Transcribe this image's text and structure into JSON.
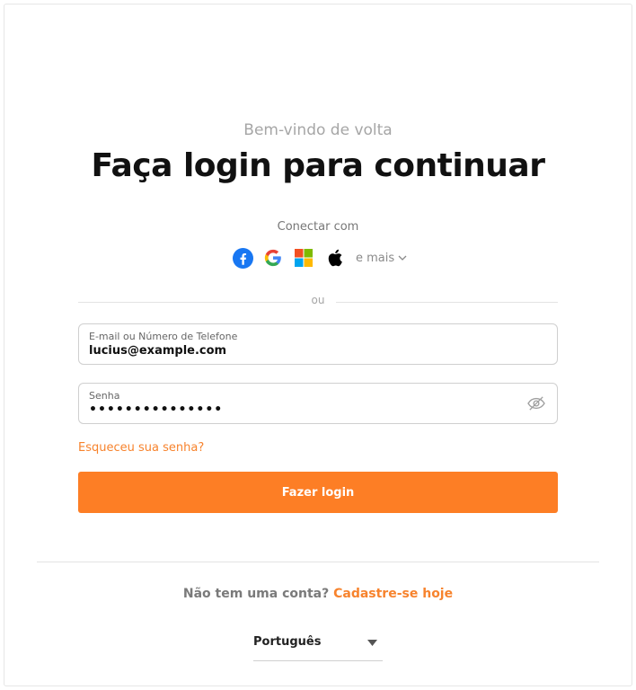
{
  "header": {
    "welcome": "Bem-vindo de volta",
    "title": "Faça login para continuar"
  },
  "social": {
    "label": "Conectar com",
    "providers": [
      "facebook-icon",
      "google-icon",
      "microsoft-icon",
      "apple-icon"
    ],
    "more_label": "e mais"
  },
  "divider": {
    "or": "ou"
  },
  "form": {
    "email_label": "E-mail ou Número de Telefone",
    "email_value": "lucius@example.com",
    "password_label": "Senha",
    "password_value": "•••••••••••••••",
    "forgot_label": "Esqueceu sua senha?",
    "login_label": "Fazer login"
  },
  "footer": {
    "signup_question": "Não tem uma conta?",
    "signup_link": "Cadastre-se hoje",
    "language": "Português"
  },
  "colors": {
    "accent": "#fd7e25",
    "link": "#f7832d",
    "facebook": "#1877f2"
  }
}
